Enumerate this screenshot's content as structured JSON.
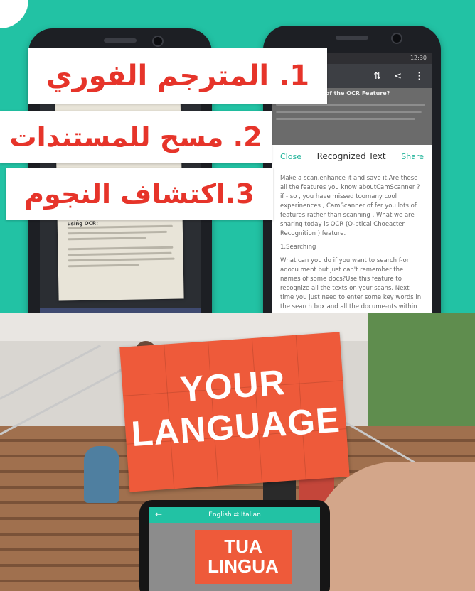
{
  "labels": {
    "item1": "1. المترجم الفوري",
    "item2": "2. مسح للمستندات",
    "item3": "3.اكتشاف النجوم"
  },
  "phone_left": {
    "paper_heading": "Why wait? Follow the steps to start using OCR:",
    "toolbar_icons": [
      "back-arrow-icon",
      "rotate-left-icon",
      "rotate-right-icon",
      "adjust-icon",
      "check-icon"
    ],
    "toolbar_glyphs": [
      "←",
      "↺",
      "↻",
      "⇌",
      "✓"
    ]
  },
  "phone_right": {
    "time": "12:30",
    "app_bar_title": "d",
    "doc_heading": "ise of the OCR Feature?",
    "close_label": "Close",
    "title": "Recognized Text",
    "share_label": "Share",
    "paragraph1": "Make a scan,enhance it and save it.Are these all the features you know aboutCamScanner ? if - so , you have missed toomany cool experinences , CamScanner of fer you lots of features rather than scanning . What we are sharing today is OCR (O-ptical Choeacter Recognition ) feature.",
    "section": "1.Searching",
    "paragraph2": "What can you do if you want to search f-or adocu ment but just can't remember the names of some docs?Use this feature to recognize all the texts on your scans. Next time you just need to enter some key words in the search box and all the docume-nts within the words will be found."
  },
  "photo": {
    "sign_line1": "YOUR",
    "sign_line2": "LANGUAGE",
    "device_lang_bar": "English ⇄ Italian",
    "device_line1": "TUA",
    "device_line2": "LINGUA"
  },
  "colors": {
    "teal": "#22c2a4",
    "label_red": "#e6342a",
    "sign_orange": "#ee5a3a",
    "toolbar_blue": "#3f4a70"
  }
}
